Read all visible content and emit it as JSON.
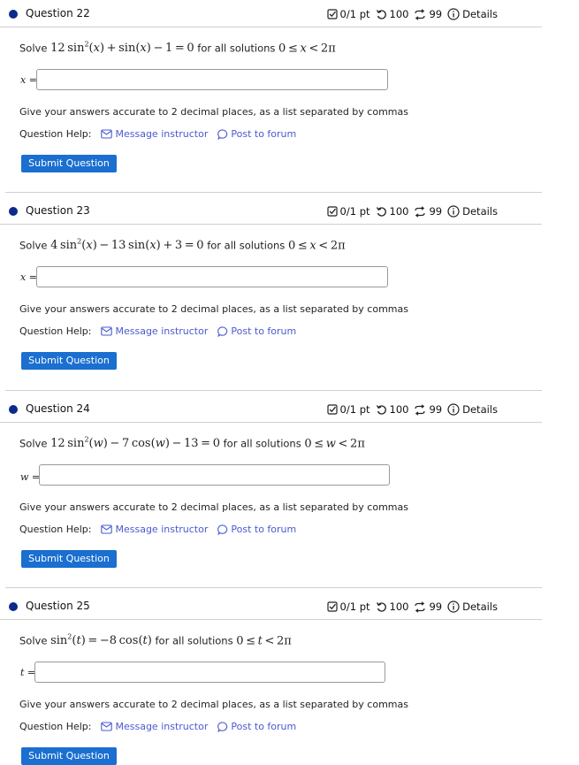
{
  "questions": [
    {
      "title": "Question 22",
      "points": "0/1 pt",
      "attempts": "100",
      "retries": "99",
      "details": "Details",
      "eq_prefix": "Solve",
      "eq_suffix": "for all solutions",
      "var": "x",
      "var_label": "x =",
      "instructions": "Give your answers accurate to 2 decimal places, as a list separated by commas",
      "help_label": "Question Help:",
      "message_label": "Message instructor",
      "forum_label": "Post to forum",
      "submit_label": "Submit Question",
      "answer_value": ""
    },
    {
      "title": "Question 23",
      "points": "0/1 pt",
      "attempts": "100",
      "retries": "99",
      "details": "Details",
      "eq_prefix": "Solve",
      "eq_suffix": "for all solutions",
      "var": "x",
      "var_label": "x =",
      "instructions": "Give your answers accurate to 2 decimal places, as a list separated by commas",
      "help_label": "Question Help:",
      "message_label": "Message instructor",
      "forum_label": "Post to forum",
      "submit_label": "Submit Question",
      "answer_value": ""
    },
    {
      "title": "Question 24",
      "points": "0/1 pt",
      "attempts": "100",
      "retries": "99",
      "details": "Details",
      "eq_prefix": "Solve",
      "eq_suffix": "for all solutions",
      "var": "w",
      "var_label": "w =",
      "instructions": "Give your answers accurate to 2 decimal places, as a list separated by commas",
      "help_label": "Question Help:",
      "message_label": "Message instructor",
      "forum_label": "Post to forum",
      "submit_label": "Submit Question",
      "answer_value": ""
    },
    {
      "title": "Question 25",
      "points": "0/1 pt",
      "attempts": "100",
      "retries": "99",
      "details": "Details",
      "eq_prefix": "Solve",
      "eq_suffix": "for all solutions",
      "var": "t",
      "var_label": "t =",
      "instructions": "Give your answers accurate to 2 decimal places, as a list separated by commas",
      "help_label": "Question Help:",
      "message_label": "Message instructor",
      "forum_label": "Post to forum",
      "submit_label": "Submit Question",
      "answer_value": ""
    }
  ],
  "equations": {
    "q22": {
      "a": "12",
      "f1": "sin",
      "exp": "2",
      "x": "x",
      "plus": "+",
      "f2": "sin",
      "minus": "−",
      "c": "1",
      "eq": "=",
      "zero": "0"
    },
    "q23": {
      "a": "4",
      "f1": "sin",
      "exp": "2",
      "x": "x",
      "minus": "−",
      "b": "13",
      "f2": "sin",
      "plus": "+",
      "c": "3",
      "eq": "=",
      "zero": "0"
    },
    "q24": {
      "a": "12",
      "f1": "sin",
      "exp": "2",
      "x": "w",
      "minus1": "−",
      "b": "7",
      "f2": "cos",
      "minus2": "−",
      "c": "13",
      "eq": "=",
      "zero": "0"
    },
    "q25": {
      "f1": "sin",
      "exp": "2",
      "x": "t",
      "eq": "=",
      "neg": "−8",
      "f2": "cos"
    }
  },
  "range": {
    "lo": "0",
    "le": "≤",
    "lt": "<",
    "hi": "2π"
  },
  "colors": {
    "accent": "#1a6fd0",
    "dot": "#0b2a8a",
    "link": "#4a5ad0"
  }
}
